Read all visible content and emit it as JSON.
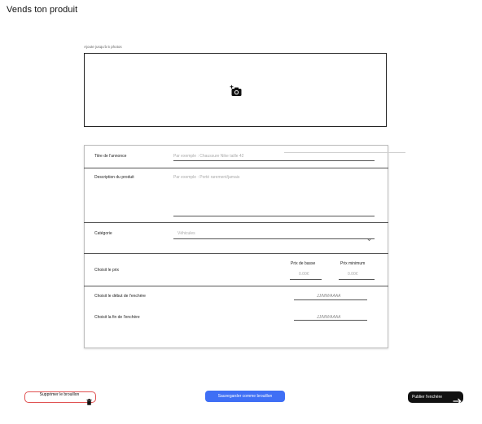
{
  "page": {
    "title": "Vends ton produit"
  },
  "photos": {
    "hint": "Ajoute jusqu'à 5 photos",
    "add_icon": "add-photo-camera-icon"
  },
  "form": {
    "title_field": {
      "label": "Titre de l'annonce",
      "placeholder": "Par exemple : Chaussure Nike taille 42"
    },
    "description_field": {
      "label": "Description du produit",
      "placeholder": "Par exemple : Porté rarement/jamais"
    },
    "category_field": {
      "label": "Catégorie",
      "value": "Véhicules",
      "icon": "chevron-down-icon"
    },
    "price": {
      "label": "Choisit le prix",
      "base_label": "Prix de basse",
      "base_placeholder": "0.00€",
      "min_label": "Prix minimum",
      "min_placeholder": "0.00€"
    },
    "auction_start": {
      "label": "Choisit le début de l'enchère",
      "placeholder": "JJ/MM/AAAA"
    },
    "auction_end": {
      "label": "Choisit la fin de l'enchère",
      "placeholder": "JJ/MM/AAAA"
    }
  },
  "actions": {
    "delete_label": "Supprimer le brouillon",
    "save_label": "Sauvegarder comme brouillon",
    "publish_label": "Publier l'enchère"
  },
  "colors": {
    "save_button": "#3f6ff5",
    "delete_border": "#e05050",
    "publish_button": "#111111"
  }
}
